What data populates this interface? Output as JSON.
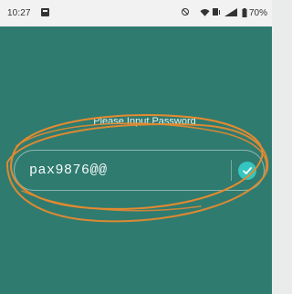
{
  "status_bar": {
    "time": "10:27",
    "battery": "70%"
  },
  "icons": {
    "notification": "notification-icon",
    "dnd": "do-not-disturb-icon",
    "wifi": "wifi-icon",
    "data": "mobile-data-icon",
    "signal": "signal-icon",
    "battery": "battery-icon",
    "confirm": "check-icon"
  },
  "login": {
    "prompt": "Please Input Password",
    "password_value": "pax9876@@"
  },
  "colors": {
    "background": "#2f7b70",
    "accent": "#34c6c0",
    "annotation": "#e58a2f"
  }
}
